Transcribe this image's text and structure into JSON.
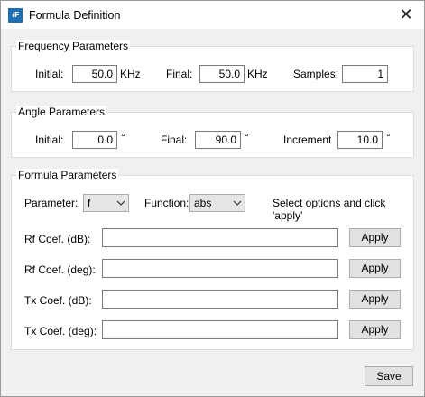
{
  "window": {
    "title": "Formula Definition",
    "icon_text": "ıiF",
    "close_glyph": "✕"
  },
  "frequency": {
    "legend": "Frequency Parameters",
    "initial_label": "Initial:",
    "initial_value": "50.0",
    "initial_unit": "KHz",
    "final_label": "Final:",
    "final_value": "50.0",
    "final_unit": "KHz",
    "samples_label": "Samples:",
    "samples_value": "1"
  },
  "angle": {
    "legend": "Angle Parameters",
    "initial_label": "Initial:",
    "initial_value": "0.0",
    "initial_unit": "°",
    "final_label": "Final:",
    "final_value": "90.0",
    "final_unit": "°",
    "increment_label": "Increment",
    "increment_value": "10.0",
    "increment_unit": "°"
  },
  "formula": {
    "legend": "Formula Parameters",
    "parameter_label": "Parameter:",
    "parameter_value": "f",
    "function_label": "Function:",
    "function_value": "abs",
    "hint": "Select options and click 'apply'",
    "rows": [
      {
        "label": "Rf Coef. (dB):",
        "value": "",
        "button": "Apply"
      },
      {
        "label": "Rf Coef. (deg):",
        "value": "",
        "button": "Apply"
      },
      {
        "label": "Tx Coef. (dB):",
        "value": "",
        "button": "Apply"
      },
      {
        "label": "Tx Coef. (deg):",
        "value": "",
        "button": "Apply"
      }
    ]
  },
  "footer": {
    "save_label": "Save"
  }
}
